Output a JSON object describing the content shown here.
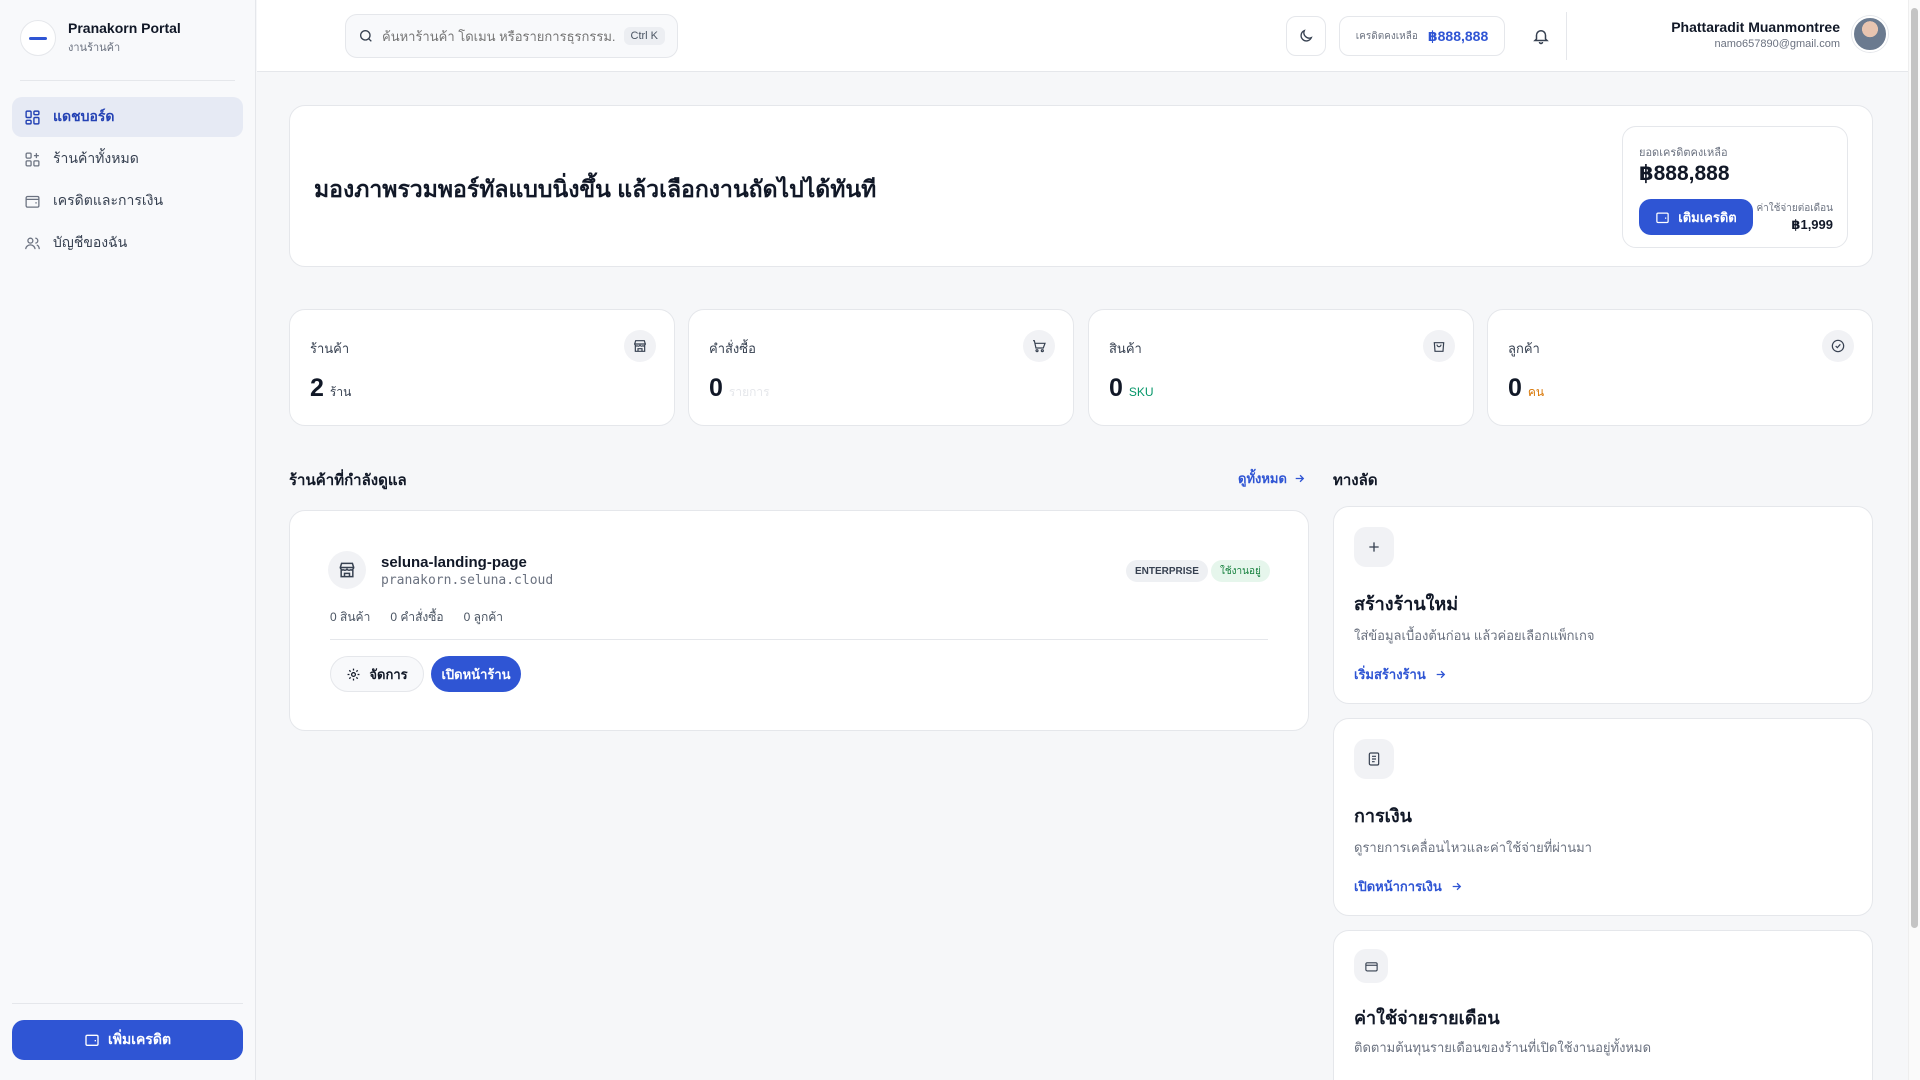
{
  "sidebar": {
    "brand_title": "Pranakorn Portal",
    "brand_subtitle": "งานร้านค้า",
    "items": [
      {
        "label": "แดชบอร์ด",
        "icon": "grid-icon",
        "active": true
      },
      {
        "label": "ร้านค้าทั้งหมด",
        "icon": "store-grid-icon",
        "active": false
      },
      {
        "label": "เครดิตและการเงิน",
        "icon": "wallet-icon",
        "active": false
      },
      {
        "label": "บัญชีของฉัน",
        "icon": "users-icon",
        "active": false
      }
    ],
    "cta_label": "เพิ่มเครดิต"
  },
  "topbar": {
    "search_placeholder": "ค้นหาร้านค้า โดเมน หรือรายการธุรกรรม...",
    "search_shortcut": "Ctrl K",
    "credit_label": "เครดิตคงเหลือ",
    "credit_value": "฿888,888",
    "user_name": "Phattaradit Muanmontree",
    "user_email": "namo657890@gmail.com"
  },
  "hero": {
    "title": "มองภาพรวมพอร์ทัลแบบนิ่งขึ้น แล้วเลือกงานถัดไปได้ทันที",
    "balance_label": "ยอดเครดิตคงเหลือ",
    "balance_value": "฿888,888",
    "topup_label": "เติมเครดิต",
    "monthly_label": "ค่าใช้จ่ายต่อเดือน",
    "monthly_value": "฿1,999"
  },
  "stats": [
    {
      "label": "ร้านค้า",
      "value": "2",
      "unit": "ร้าน",
      "unit_color": "#374151",
      "icon": "store-icon"
    },
    {
      "label": "คำสั่งซื้อ",
      "value": "0",
      "unit": "รายการ",
      "unit_color": "#e5e7eb",
      "icon": "cart-icon"
    },
    {
      "label": "สินค้า",
      "value": "0",
      "unit": "SKU",
      "unit_color": "#059669",
      "icon": "bag-icon"
    },
    {
      "label": "ลูกค้า",
      "value": "0",
      "unit": "คน",
      "unit_color": "#d97706",
      "icon": "check-circle-icon"
    }
  ],
  "stores_section": {
    "title": "ร้านค้าที่กำลังดูแล",
    "view_all": "ดูทั้งหมด",
    "store": {
      "name": "seluna-landing-page",
      "domain": "pranakorn.seluna.cloud",
      "plan": "ENTERPRISE",
      "status": "ใช้งานอยู่",
      "meta": [
        "0 สินค้า",
        "0 คำสั่งซื้อ",
        "0 ลูกค้า"
      ],
      "manage_label": "จัดการ",
      "open_label": "เปิดหน้าร้าน"
    }
  },
  "shortcuts": {
    "title": "ทางลัด",
    "items": [
      {
        "title": "สร้างร้านใหม่",
        "desc": "ใส่ข้อมูลเบื้องต้นก่อน แล้วค่อยเลือกแพ็กเกจ",
        "link": "เริ่มสร้างร้าน",
        "icon": "plus-icon"
      },
      {
        "title": "การเงิน",
        "desc": "ดูรายการเคลื่อนไหวและค่าใช้จ่ายที่ผ่านมา",
        "link": "เปิดหน้าการเงิน",
        "icon": "document-icon"
      },
      {
        "title": "ค่าใช้จ่ายรายเดือน",
        "desc": "ติดตามต้นทุนรายเดือนของร้านที่เปิดใช้งานอยู่ทั้งหมด",
        "link": "",
        "icon": "credit-card-icon"
      }
    ]
  },
  "colors": {
    "accent": "#2f55d4",
    "active_nav_bg": "#e6eaf4",
    "status_green": "#15803d"
  }
}
